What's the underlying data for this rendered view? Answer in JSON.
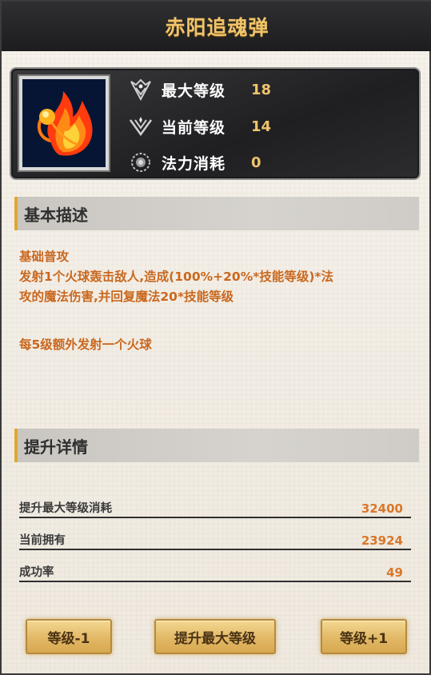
{
  "title": "赤阳追魂弹",
  "skill": {
    "icon": "fireball-icon",
    "stats": [
      {
        "icon": "max-level-emblem-icon",
        "label": "最大等级",
        "value": "18"
      },
      {
        "icon": "current-level-emblem-icon",
        "label": "当前等级",
        "value": "14"
      },
      {
        "icon": "mana-orb-icon",
        "label": "法力消耗",
        "value": "0"
      }
    ]
  },
  "basic": {
    "header": "基本描述",
    "type": "基础普攻",
    "line1": "发射1个火球轰击敌人,造成(100%+20%*技能等级)*法",
    "line2": "攻的魔法伤害,并回复魔法20*技能等级",
    "extra": "每5级额外发射一个火球"
  },
  "upgrade": {
    "header": "提升详情",
    "rows": [
      {
        "label": "提升最大等级消耗",
        "value": "32400"
      },
      {
        "label": "当前拥有",
        "value": "23924"
      },
      {
        "label": "成功率",
        "value": "49"
      }
    ]
  },
  "buttons": {
    "level_down": "等级-1",
    "raise_max": "提升最大等级",
    "level_up": "等级+1"
  },
  "colors": {
    "title": "#f0c46a",
    "desc_text": "#c9681f",
    "button": "#e2b866"
  }
}
